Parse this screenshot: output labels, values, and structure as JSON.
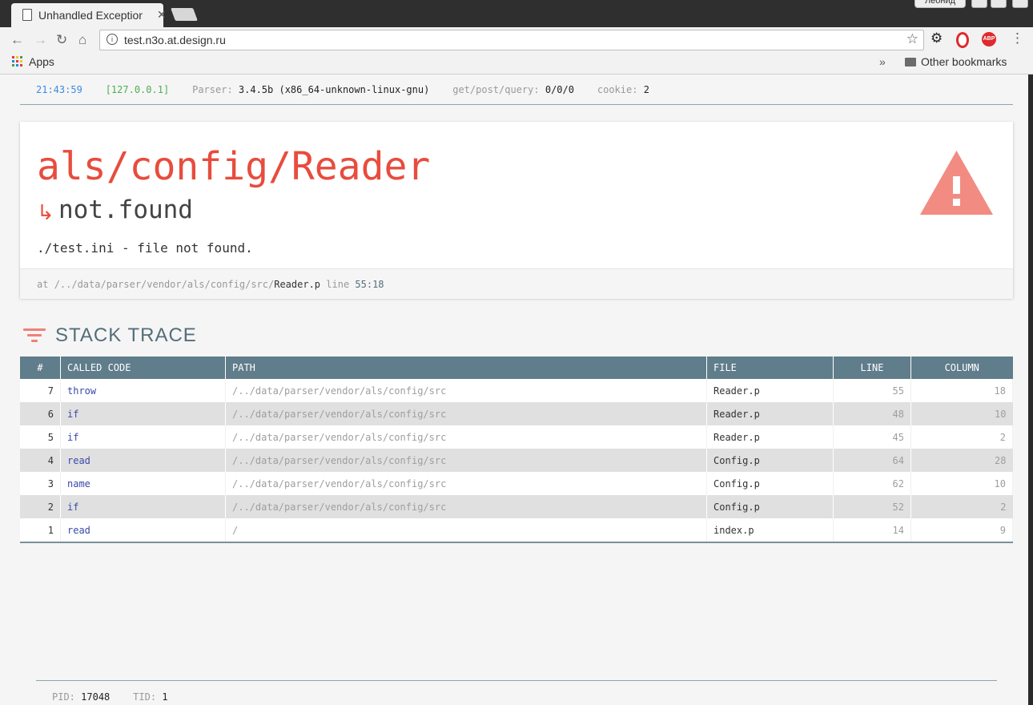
{
  "browser": {
    "tab_title": "Unhandled Exception",
    "url": "test.n3o.at.design.ru",
    "user": "Леонид",
    "bookmarks": {
      "apps": "Apps",
      "overflow": "»",
      "other": "Other bookmarks"
    }
  },
  "meta": {
    "time": "21:43:59",
    "ip": "[127.0.0.1]",
    "parser_label": "Parser:",
    "parser_value": "3.4.5b (x86_64-unknown-linux-gnu)",
    "gpq_label": "get/post/query:",
    "gpq_value": "0/0/0",
    "cookie_label": "cookie:",
    "cookie_value": "2"
  },
  "error": {
    "source": "als/config/Reader",
    "arrow": "↳",
    "type": "not.found",
    "message": "./test.ini - file not found.",
    "at_label": "at",
    "at_path": "/../data/parser/vendor/als/config/src/",
    "at_file": "Reader.p",
    "line_label": "line",
    "line_value": "55:18"
  },
  "stack": {
    "title": "STACK TRACE",
    "headers": [
      "#",
      "CALLED CODE",
      "PATH",
      "FILE",
      "LINE",
      "COLUMN"
    ],
    "rows": [
      [
        "7",
        "throw",
        "/../data/parser/vendor/als/config/src",
        "Reader.p",
        "55",
        "18"
      ],
      [
        "6",
        "if",
        "/../data/parser/vendor/als/config/src",
        "Reader.p",
        "48",
        "10"
      ],
      [
        "5",
        "if",
        "/../data/parser/vendor/als/config/src",
        "Reader.p",
        "45",
        "2"
      ],
      [
        "4",
        "read",
        "/../data/parser/vendor/als/config/src",
        "Config.p",
        "64",
        "28"
      ],
      [
        "3",
        "name",
        "/../data/parser/vendor/als/config/src",
        "Config.p",
        "62",
        "10"
      ],
      [
        "2",
        "if",
        "/../data/parser/vendor/als/config/src",
        "Config.p",
        "52",
        "2"
      ],
      [
        "1",
        "read",
        "/",
        "index.p",
        "14",
        "9"
      ]
    ]
  },
  "footer": {
    "pid_label": "PID:",
    "pid_value": "17048",
    "tid_label": "TID:",
    "tid_value": "1"
  },
  "colors": {
    "error_red": "#e84c3d",
    "warning_triangle": "#f28b82",
    "table_header": "#607d8b",
    "called_code": "#3949ab"
  }
}
